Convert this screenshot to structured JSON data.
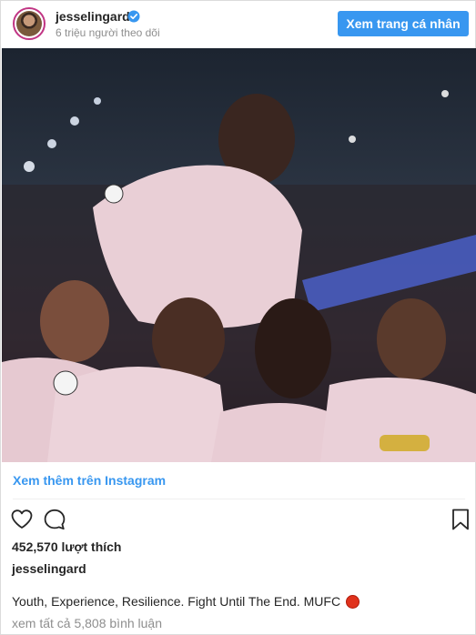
{
  "header": {
    "username": "jesselingard",
    "followers": "6 triệu người theo dõi",
    "profile_button": "Xem trang cá nhân"
  },
  "post": {
    "view_more": "Xem thêm trên Instagram",
    "likes": "452,570 lượt thích",
    "owner": "jesselingard",
    "caption": "Youth, Experience, Resilience. Fight Until The End. MUFC",
    "view_comments": "xem tất cả 5,808 bình luận"
  },
  "icons": {
    "like": "heart-icon",
    "comment": "comment-icon",
    "save": "bookmark-icon",
    "verified": "verified-badge-icon",
    "caption_emoji": "red-circle-icon"
  },
  "colors": {
    "accent": "#3897f0",
    "text": "#262626",
    "muted": "#8e8e8e",
    "verified": "#3897f0",
    "emoji": "#e0321c"
  }
}
